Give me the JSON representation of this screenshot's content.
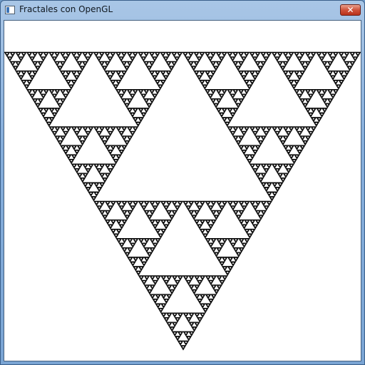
{
  "window": {
    "title": "Fractales con OpenGL",
    "close_glyph": "✕",
    "icon": "app-window-icon"
  },
  "colors": {
    "fractal_fill": "#000000",
    "canvas_background": "#ffffff",
    "close_button": "#c94a33"
  },
  "fractal": {
    "type": "sierpinski-triangle",
    "orientation": "inverted"
  }
}
